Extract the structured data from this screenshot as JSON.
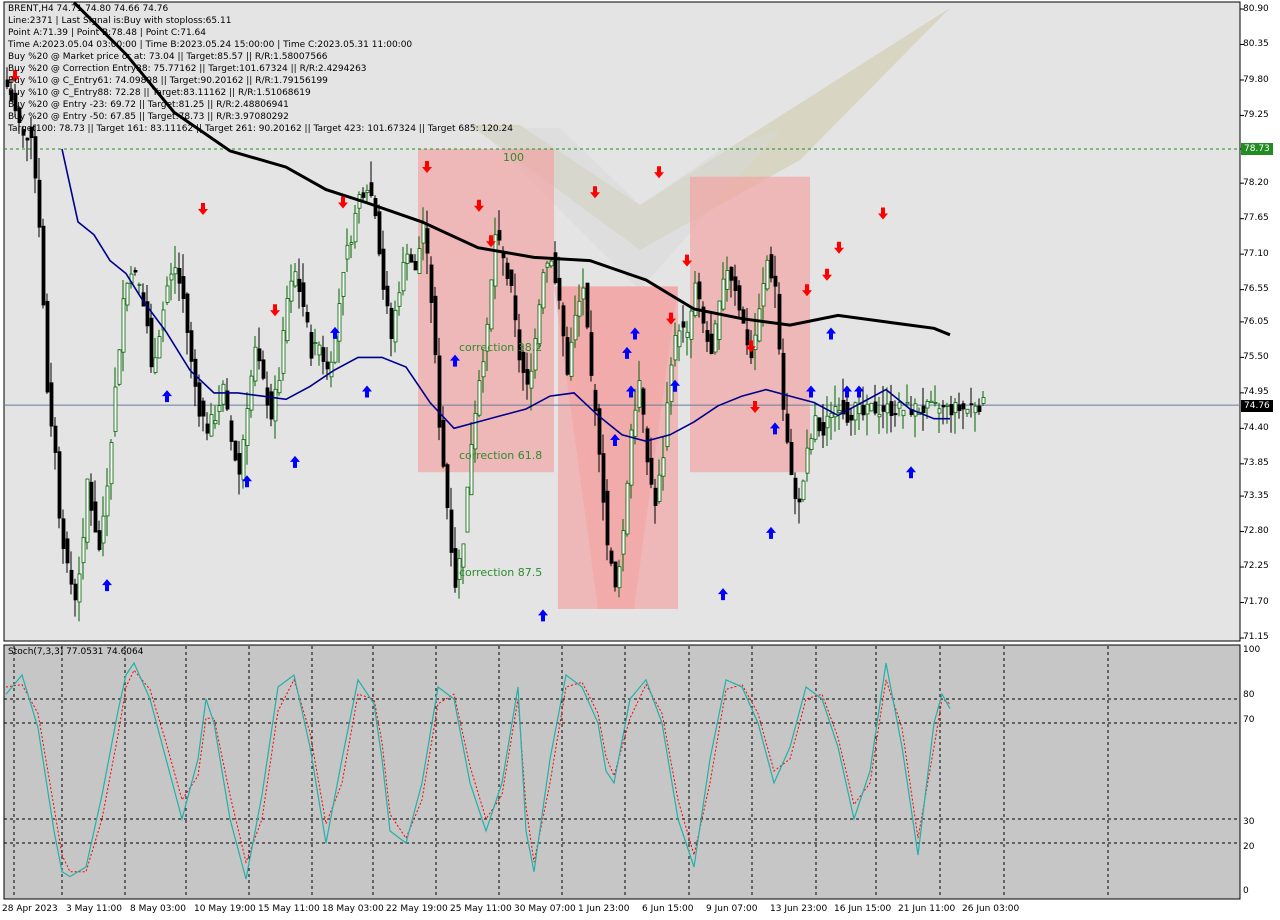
{
  "header": {
    "lines": [
      "BRENT,H4  74.71 74.80 74.66 74.76",
      "Line:2371  | Last Signal is:Buy with stoploss:65.11",
      "Point A:71.39 | Point B:78.48 | Point C:71.64",
      "Time A:2023.05.04 03:00:00 | Time B:2023.05.24 15:00:00 | Time C:2023.05.31 11:00:00",
      "Buy %20 @ Market price or at: 73.04 || Target:85.57 || R/R:1.58007566",
      "Buy %20 @ Correction Entry38: 75.77162 || Target:101.67324 || R/R:2.4294263",
      "Buy %10 @ C_Entry61: 74.09898 || Target:90.20162 || R/R:1.79156199",
      "Buy %10 @ C_Entry88: 72.28 || Target:83.11162 || R/R:1.51068619",
      "Buy %20 @ Entry -23: 69.72 || Target:81.25 || R/R:2.48806941",
      "Buy %20 @ Entry -50: 67.85 || Target:78.73 || R/R:3.97080292",
      "Target100: 78.73 || Target 161: 83.11162 || Target 261: 90.20162 || Target 423: 101.67324 || Target 685: 120.24"
    ]
  },
  "stoch_label": "Stoch(7,3,3) 77.0531 74.6064",
  "price_axis": [
    "80.90",
    "80.35",
    "79.80",
    "79.25",
    "78.73",
    "78.20",
    "77.65",
    "77.10",
    "76.55",
    "76.05",
    "75.50",
    "74.95",
    "74.40",
    "73.85",
    "73.35",
    "72.80",
    "72.25",
    "71.70",
    "71.15"
  ],
  "stoch_axis": [
    "100",
    "80",
    "70",
    "30",
    "20",
    "0"
  ],
  "time_axis": [
    "28 Apr 2023",
    "3 May 11:00",
    "8 May 03:00",
    "10 May 19:00",
    "15 May 11:00",
    "18 May 03:00",
    "22 May 19:00",
    "25 May 11:00",
    "30 May 07:00",
    "1 Jun 23:00",
    "6 Jun 15:00",
    "9 Jun 07:00",
    "13 Jun 23:00",
    "16 Jun 15:00",
    "21 Jun 11:00",
    "26 Jun 03:00"
  ],
  "price_tags": {
    "target": "78.73",
    "current": "74.76"
  },
  "annotations": {
    "level100": "100",
    "corr38": "correction 38.2",
    "corr61": "correction 61.8",
    "corr87": "correction 87.5"
  },
  "colors": {
    "up_candle": "#006400",
    "down_candle": "#000000",
    "ma_fast": "#00008b",
    "ma_slow": "#000000",
    "buy_arrow": "#0000ff",
    "sell_arrow": "#ff0000",
    "stoch_main": "#20b2aa",
    "stoch_signal": "#ff0000",
    "target_line": "#228b22"
  },
  "chart_data": {
    "type": "candlestick",
    "symbol": "BRENT",
    "timeframe": "H4",
    "ohlc_last": {
      "open": 74.71,
      "high": 74.8,
      "low": 74.66,
      "close": 74.76
    },
    "ylim": [
      71.15,
      80.9
    ],
    "levels": {
      "target100": 78.73,
      "current": 74.76
    },
    "close_path": {
      "t": [
        0,
        2,
        4,
        6,
        8,
        10,
        12,
        13,
        15,
        17,
        19,
        20,
        21,
        23,
        25,
        27,
        29,
        31,
        33,
        35,
        36,
        38,
        40,
        42,
        44,
        46,
        48,
        50,
        52,
        54,
        56,
        58,
        60,
        62,
        64,
        66,
        68,
        70,
        72,
        74,
        76,
        78,
        80,
        82,
        84,
        86,
        88,
        90,
        92,
        94,
        96,
        98,
        100,
        102,
        104,
        106,
        108,
        110,
        112,
        114,
        116,
        118,
        120,
        122,
        124,
        126,
        128,
        130,
        132,
        134,
        136,
        138,
        140,
        142,
        144,
        146,
        148,
        150,
        152,
        154,
        156,
        158,
        160,
        162,
        164,
        166,
        168,
        170,
        172,
        174,
        176,
        178,
        180,
        182,
        184,
        186,
        188,
        190,
        192,
        194,
        196,
        198,
        200,
        202,
        204,
        206,
        208,
        210,
        212,
        214,
        216,
        218,
        220,
        222,
        224,
        226,
        228,
        230,
        232,
        234,
        236,
        238,
        240,
        242,
        244,
        246,
        248
      ],
      "v": [
        79.7,
        79.3,
        78.9,
        79.0,
        77.6,
        75.0,
        74.0,
        73.1,
        72.2,
        71.8,
        72.6,
        73.6,
        73.2,
        72.5,
        73.6,
        75.0,
        76.4,
        76.9,
        76.6,
        76.0,
        75.3,
        75.9,
        76.6,
        76.9,
        76.4,
        75.4,
        74.7,
        74.4,
        74.6,
        75.0,
        74.2,
        73.7,
        74.8,
        75.6,
        75.1,
        74.6,
        75.2,
        76.4,
        76.8,
        76.3,
        75.6,
        75.7,
        75.3,
        75.8,
        76.9,
        77.4,
        78.0,
        78.2,
        77.8,
        76.6,
        75.8,
        76.6,
        77.2,
        76.8,
        77.6,
        76.4,
        74.5,
        73.2,
        72.0,
        72.7,
        74.2,
        75.2,
        75.9,
        77.4,
        77.0,
        76.5,
        75.5,
        75.0,
        75.8,
        76.9,
        77.1,
        76.3,
        75.3,
        76.1,
        76.6,
        75.1,
        74.1,
        72.6,
        71.9,
        72.8,
        74.4,
        75.1,
        73.9,
        73.2,
        74.0,
        75.5,
        76.0,
        75.8,
        76.6,
        76.0,
        75.5,
        76.3,
        76.9,
        76.6,
        76.0,
        75.5,
        76.2,
        77.0,
        76.6,
        74.7,
        73.6,
        73.2,
        74.0,
        74.5,
        74.3,
        74.7,
        74.8,
        74.6,
        74.7,
        74.6,
        74.7,
        74.7,
        74.7,
        74.7,
        74.7,
        74.7,
        74.7,
        74.7,
        74.7,
        74.7,
        74.7,
        74.7,
        74.7,
        74.8,
        74.76
      ]
    },
    "ma_fast": {
      "t": [
        14,
        18,
        22,
        26,
        30,
        34,
        40,
        46,
        52,
        58,
        64,
        70,
        76,
        82,
        88,
        94,
        100,
        106,
        112,
        118,
        124,
        130,
        136,
        142,
        148,
        154,
        160,
        166,
        172,
        178,
        184,
        190,
        196,
        202,
        208,
        214,
        220,
        226,
        232,
        236
      ],
      "v": [
        78.73,
        77.6,
        77.4,
        77.0,
        76.8,
        76.4,
        75.9,
        75.3,
        74.95,
        74.95,
        74.9,
        74.85,
        75.05,
        75.3,
        75.5,
        75.5,
        75.35,
        74.8,
        74.4,
        74.5,
        74.6,
        74.7,
        74.9,
        74.95,
        74.6,
        74.3,
        74.2,
        74.3,
        74.5,
        74.75,
        74.9,
        75.0,
        74.9,
        74.8,
        74.6,
        74.8,
        75.0,
        74.7,
        74.55,
        74.55
      ]
    },
    "ma_slow": {
      "t": [
        17,
        30,
        42,
        56,
        70,
        80,
        90,
        104,
        118,
        132,
        146,
        160,
        172,
        184,
        196,
        208,
        220,
        232,
        236
      ],
      "v": [
        81.0,
        80.2,
        79.3,
        78.7,
        78.45,
        78.1,
        77.9,
        77.6,
        77.2,
        77.05,
        77.0,
        76.7,
        76.25,
        76.1,
        76.0,
        76.15,
        76.05,
        75.95,
        75.85
      ]
    },
    "buy_signals": [
      {
        "t": 25,
        "v": 71.97
      },
      {
        "t": 40,
        "v": 74.9
      },
      {
        "t": 60,
        "v": 73.58
      },
      {
        "t": 72,
        "v": 73.88
      },
      {
        "t": 82,
        "v": 75.88
      },
      {
        "t": 90,
        "v": 74.97
      },
      {
        "t": 112,
        "v": 75.45
      },
      {
        "t": 134,
        "v": 71.5
      },
      {
        "t": 152,
        "v": 74.22
      },
      {
        "t": 155,
        "v": 75.57
      },
      {
        "t": 156,
        "v": 74.97
      },
      {
        "t": 157,
        "v": 75.87
      },
      {
        "t": 167,
        "v": 75.06
      },
      {
        "t": 179,
        "v": 71.83
      },
      {
        "t": 191,
        "v": 72.78
      },
      {
        "t": 192,
        "v": 74.4
      },
      {
        "t": 201,
        "v": 74.97
      },
      {
        "t": 206,
        "v": 75.87
      },
      {
        "t": 210,
        "v": 74.97
      },
      {
        "t": 213,
        "v": 74.97
      },
      {
        "t": 226,
        "v": 73.72
      }
    ],
    "sell_signals": [
      {
        "t": 2,
        "v": 79.86
      },
      {
        "t": 49,
        "v": 77.8
      },
      {
        "t": 67,
        "v": 76.23
      },
      {
        "t": 84,
        "v": 77.9
      },
      {
        "t": 105,
        "v": 78.45
      },
      {
        "t": 118,
        "v": 77.85
      },
      {
        "t": 121,
        "v": 77.3
      },
      {
        "t": 147,
        "v": 78.06
      },
      {
        "t": 163,
        "v": 78.37
      },
      {
        "t": 166,
        "v": 76.1
      },
      {
        "t": 170,
        "v": 77.0
      },
      {
        "t": 186,
        "v": 75.67
      },
      {
        "t": 187,
        "v": 74.73
      },
      {
        "t": 200,
        "v": 76.54
      },
      {
        "t": 205,
        "v": 76.78
      },
      {
        "t": 208,
        "v": 77.2
      },
      {
        "t": 219,
        "v": 77.73
      }
    ],
    "pattern_zones": [
      {
        "t0": 103,
        "t1": 137,
        "v0": 73.72,
        "v1": 78.73,
        "color": "#f4a0a0"
      },
      {
        "t0": 138,
        "t1": 168,
        "v0": 71.6,
        "v1": 76.6,
        "color": "#f4a0a0"
      },
      {
        "t0": 171,
        "t1": 201,
        "v0": 73.72,
        "v1": 78.3,
        "color": "#f4a0a0"
      }
    ],
    "stochastic": {
      "params": "Stoch(7,3,3)",
      "main": 77.0531,
      "signal": 74.6064,
      "levels": [
        80,
        70,
        30,
        20
      ],
      "ylim": [
        0,
        100
      ],
      "main_path": {
        "t": [
          0,
          4,
          8,
          12,
          14,
          16,
          20,
          24,
          28,
          30,
          32,
          36,
          40,
          44,
          48,
          50,
          52,
          56,
          60,
          64,
          68,
          72,
          76,
          80,
          84,
          88,
          92,
          94,
          96,
          100,
          104,
          108,
          112,
          116,
          120,
          124,
          128,
          130,
          132,
          136,
          140,
          144,
          148,
          150,
          152,
          156,
          160,
          164,
          168,
          172,
          176,
          180,
          184,
          188,
          192,
          196,
          200,
          204,
          208,
          212,
          216,
          220,
          224,
          228,
          232,
          234,
          236
        ],
        "v": [
          82,
          90,
          68,
          25,
          8,
          6,
          10,
          40,
          75,
          90,
          95,
          80,
          55,
          30,
          55,
          80,
          70,
          30,
          5,
          40,
          85,
          90,
          60,
          20,
          55,
          88,
          78,
          55,
          25,
          20,
          45,
          85,
          80,
          45,
          25,
          45,
          85,
          25,
          8,
          55,
          90,
          85,
          70,
          50,
          45,
          80,
          88,
          70,
          30,
          10,
          55,
          88,
          85,
          70,
          45,
          60,
          85,
          80,
          60,
          30,
          50,
          95,
          60,
          15,
          70,
          82,
          76
        ]
      },
      "signal_path": {
        "t": [
          0,
          4,
          8,
          12,
          14,
          16,
          20,
          24,
          28,
          30,
          32,
          36,
          40,
          44,
          48,
          50,
          52,
          56,
          60,
          64,
          68,
          72,
          76,
          80,
          84,
          88,
          92,
          94,
          96,
          100,
          104,
          108,
          112,
          116,
          120,
          124,
          128,
          130,
          132,
          136,
          140,
          144,
          148,
          150,
          152,
          156,
          160,
          164,
          168,
          172,
          176,
          180,
          184,
          188,
          192,
          196,
          200,
          204,
          208,
          212,
          216,
          220,
          224,
          228,
          232,
          234,
          236
        ],
        "v": [
          85,
          86,
          74,
          35,
          15,
          8,
          8,
          30,
          65,
          85,
          92,
          84,
          62,
          38,
          48,
          72,
          72,
          40,
          12,
          30,
          75,
          88,
          66,
          28,
          45,
          82,
          80,
          62,
          32,
          22,
          38,
          78,
          82,
          52,
          30,
          40,
          80,
          35,
          12,
          45,
          85,
          87,
          74,
          56,
          48,
          72,
          86,
          74,
          38,
          15,
          45,
          84,
          86,
          74,
          50,
          55,
          80,
          82,
          64,
          36,
          45,
          88,
          68,
          22,
          60,
          80,
          78
        ]
      }
    },
    "x_axis": {
      "labels": [
        "28 Apr 2023",
        "3 May 11:00",
        "8 May 03:00",
        "10 May 19:00",
        "15 May 11:00",
        "18 May 03:00",
        "22 May 19:00",
        "25 May 11:00",
        "30 May 07:00",
        "1 Jun 23:00",
        "6 Jun 15:00",
        "9 Jun 07:00",
        "13 Jun 23:00",
        "16 Jun 15:00",
        "21 Jun 11:00",
        "26 Jun 03:00"
      ]
    }
  }
}
